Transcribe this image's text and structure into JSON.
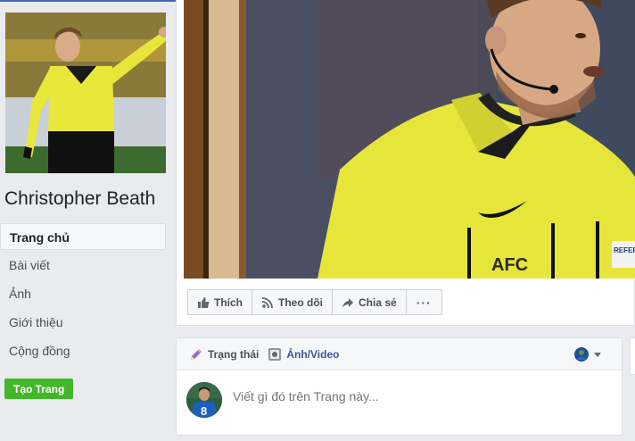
{
  "page": {
    "name": "Christopher Beath"
  },
  "nav": {
    "items": [
      {
        "label": "Trang chủ",
        "active": true
      },
      {
        "label": "Bài viết",
        "active": false
      },
      {
        "label": "Ảnh",
        "active": false
      },
      {
        "label": "Giới thiệu",
        "active": false
      },
      {
        "label": "Cộng đồng",
        "active": false
      }
    ],
    "create_page": "Tạo Trang"
  },
  "actions": {
    "like": "Thích",
    "follow": "Theo dõi",
    "share": "Chia sẻ",
    "more": "···"
  },
  "composer": {
    "status_tab": "Trạng thái",
    "photo_tab": "Ảnh/Video",
    "placeholder": "Viết gì đó trên Trang này...",
    "jersey_number": "8"
  },
  "cover": {
    "badge_text": "AFC",
    "patch_text": "REFER"
  },
  "colors": {
    "brand_blue": "#4267b2",
    "link_blue": "#365899",
    "green_button": "#42b72a",
    "referee_yellow": "#e8e83a"
  }
}
